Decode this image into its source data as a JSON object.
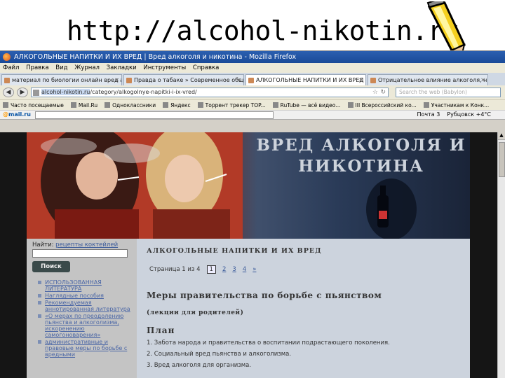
{
  "slide": {
    "title": "http://alcohol-nikotin.ru"
  },
  "browser": {
    "window_title": "АЛКОГОЛЬНЫЕ НАПИТКИ И ИХ ВРЕД | Вред алкоголя и никотина - Mozilla Firefox",
    "menu": [
      "Файл",
      "Правка",
      "Вид",
      "Журнал",
      "Закладки",
      "Инструменты",
      "Справка"
    ],
    "tabs": [
      {
        "label": "материал по биологии онлайн вред ал...",
        "active": false
      },
      {
        "label": "Правда о табаке » Современное обще...",
        "active": false
      },
      {
        "label": "АЛКОГОЛЬНЫЕ НАПИТКИ И ИХ ВРЕД | ...",
        "active": true
      },
      {
        "label": "Отрицательное влияние алкоголя, ни...",
        "active": false
      }
    ],
    "url_domain": "alcohol-nikotin.ru",
    "url_path": "/category/alkogolnye-napitki-i-ix-vred/",
    "search_placeholder": "Search the web (Babylon)",
    "bookmarks": [
      "Часто посещаемые",
      "Mail.Ru",
      "Одноклассники",
      "Яндекс",
      "Торрент трекер TOP...",
      "RuTube — всё видео...",
      "III Всероссийский ко...",
      "Участникам к Конк..."
    ],
    "mailbar": {
      "logo_a": "@",
      "logo_b": "mail.ru",
      "items": [
        "Почта 3",
        "Рубцовск +4°C"
      ]
    }
  },
  "site": {
    "banner_line1": "ВРЕД АЛКОГОЛЯ И",
    "banner_line2": "НИКОТИНА",
    "search_label": "Найти:",
    "search_link": "рецепты коктейлей",
    "search_button": "Поиск",
    "sidebar_links": [
      "ИСПОЛЬЗОВАННАЯ ЛИТЕРАТУРА",
      "Наглядные пособия",
      "Рекомендуемая аннотированная литература",
      "«О мерах по преодолению пьянства и алкоголизма, искоренению самогоноварения»",
      "административные и правовые меры по борьбе с вредными"
    ],
    "section_title": "АЛКОГОЛЬНЫЕ НАПИТКИ И ИХ ВРЕД",
    "pager": {
      "label": "Страница 1 из 4",
      "current": "1",
      "pages": [
        "2",
        "3",
        "4"
      ],
      "next": "»"
    },
    "article_title": "Меры правительства по борьбе с пьянством",
    "article_subtitle": "(лекции для родителей)",
    "plan_heading": "План",
    "plan_items": [
      "1. Забота народа и правительства о  воспитании подрастающего поколения.",
      "2. Социальный вред пьянства и алкоголизма.",
      "3. Вред алкоголя для организма."
    ]
  }
}
